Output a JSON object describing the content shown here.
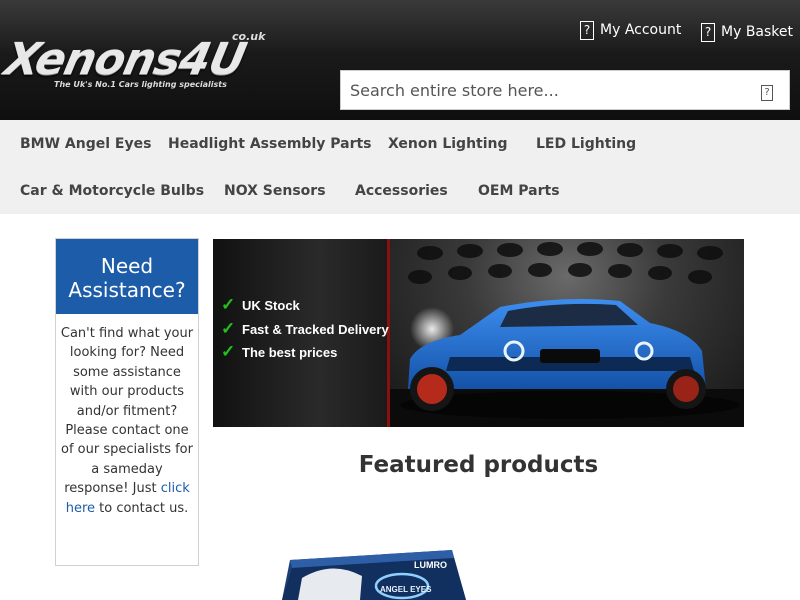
{
  "header": {
    "logo_main": "Xenons4U",
    "logo_domain": "co.uk",
    "logo_tagline": "The Uk's No.1 Cars lighting specialists",
    "account_label": "My Account",
    "basket_label": "My Basket",
    "icon_glyph": "?",
    "search_placeholder": "Search entire store here..."
  },
  "nav": {
    "items": [
      "BMW Angel Eyes",
      "Headlight Assembly Parts",
      "Xenon Lighting",
      "LED Lighting",
      "Car & Motorcycle Bulbs",
      "NOX Sensors",
      "Accessories",
      "OEM Parts"
    ]
  },
  "assist": {
    "title_line1": "Need",
    "title_line2": "Assistance?",
    "text_before": "Can't find what your looking for? Need some assistance with our products and/or fitment? Please contact one of our specialists for a sameday response! Just ",
    "link_text": "click here",
    "text_after": " to contact us."
  },
  "banner": {
    "features": [
      "UK Stock",
      "Fast & Tracked Delivery",
      "The best prices"
    ],
    "tick_glyph": "✓"
  },
  "featured": {
    "title": "Featured products",
    "product_brand": "LUMRO",
    "product_label": "ANGEL EYES"
  },
  "colors": {
    "header_bg": "#1a1a1a",
    "nav_bg": "#f0f0f0",
    "assist_blue": "#1d5ca8",
    "tick_green": "#22c21a",
    "banner_car_blue": "#1f6fd1"
  }
}
